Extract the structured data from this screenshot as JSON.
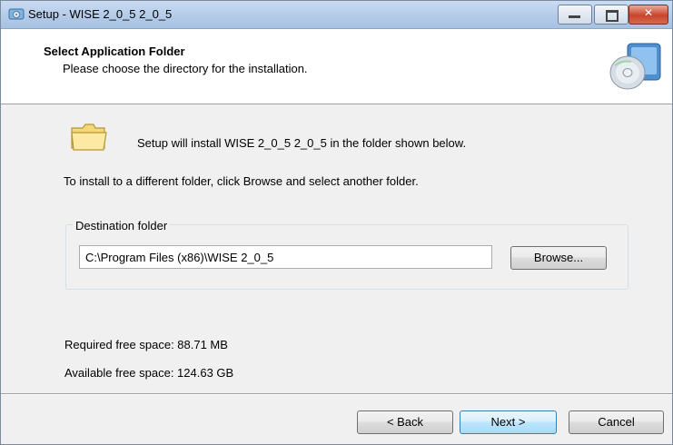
{
  "window": {
    "title": "Setup - WISE 2_0_5 2_0_5",
    "minimize_icon": "minimize-icon",
    "maximize_icon": "maximize-icon",
    "close_icon": "close-icon"
  },
  "header": {
    "title": "Select Application Folder",
    "subtitle": "Please choose the directory for the installation.",
    "icon": "disc-install-icon"
  },
  "body": {
    "folder_icon": "folder-icon",
    "message": "Setup will install WISE 2_0_5 2_0_5 in the folder shown below.",
    "instruction": "To install to a different folder, click Browse and select another folder."
  },
  "destination": {
    "label": "Destination folder",
    "path": "C:\\Program Files (x86)\\WISE 2_0_5",
    "browse_label": "Browse..."
  },
  "space": {
    "required": "Required free space: 88.71 MB",
    "available": "Available free space: 124.63 GB"
  },
  "footer": {
    "back_label": "< Back",
    "next_label": "Next >",
    "cancel_label": "Cancel"
  },
  "colors": {
    "titlebar": "#b6cde9",
    "dialog_bg": "#f0f0f0",
    "close_button": "#c9442c",
    "default_button_border": "#3c7fb1"
  }
}
